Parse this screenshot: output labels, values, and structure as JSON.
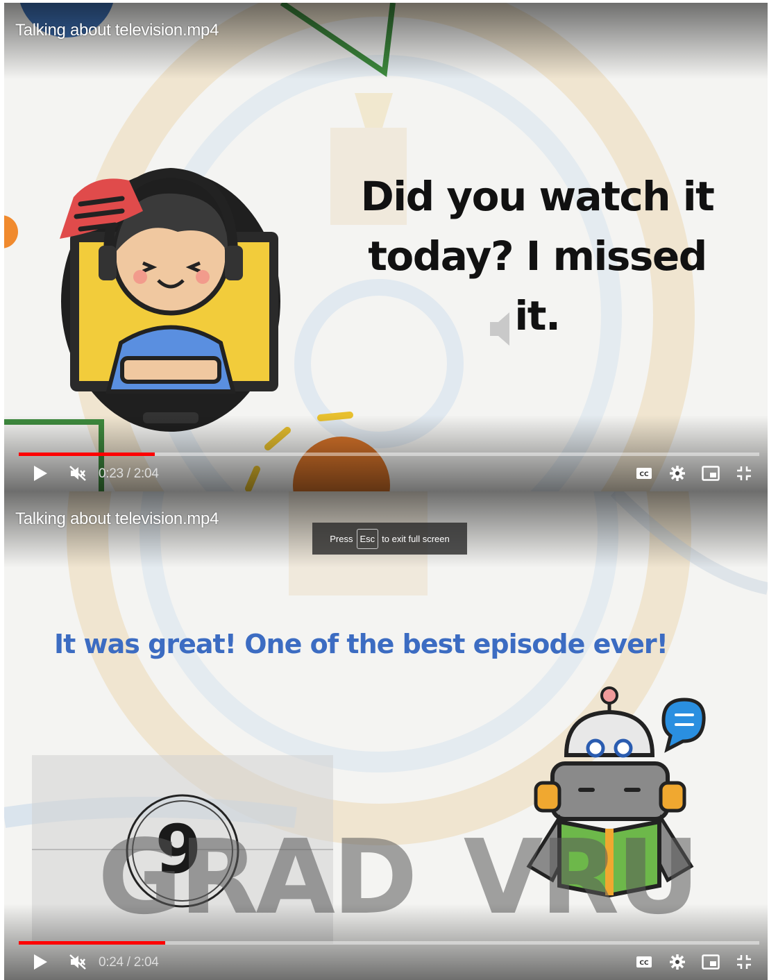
{
  "player_top": {
    "title": "Talking about television.mp4",
    "caption": "Did you watch it today? I missed it.",
    "time": "0:23 / 2:04",
    "progress_fraction": 0.184
  },
  "player_bottom": {
    "title": "Talking about television.mp4",
    "caption": "It was great! One of the best episode ever!",
    "time": "0:24 / 2:04",
    "progress_fraction": 0.198,
    "fullscreen_hint": {
      "before": "Press",
      "key": "Esc",
      "after": "to exit full screen"
    },
    "countdown": "9",
    "watermark_left": "GRAD",
    "watermark_right": "VRU"
  },
  "controls": {
    "icons": [
      "play-icon",
      "mute-icon",
      "captions-icon",
      "settings-icon",
      "miniplayer-icon",
      "exit-fullscreen-icon"
    ]
  },
  "colors": {
    "progress": "#ff0000",
    "caption_blue": "#3c6cc2"
  }
}
